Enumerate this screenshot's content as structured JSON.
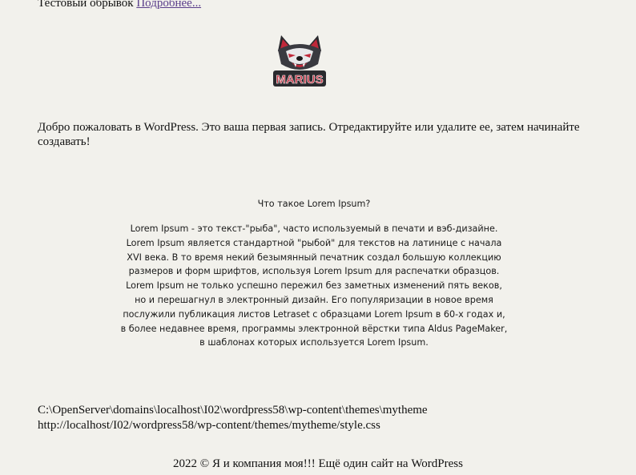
{
  "excerpt": {
    "text": "Тестовый обрывок",
    "more_link": "Подробнее..."
  },
  "logo": {
    "text": "MARIUS",
    "icon": "wolf-mascot-icon",
    "colors": {
      "red": "#c0283a",
      "dark": "#2a2a2e"
    }
  },
  "post": {
    "welcome": "Добро пожаловать в WordPress. Это ваша первая запись. Отредактируйте или удалите ее, затем начинайте создавать!"
  },
  "lorem": {
    "question": "Что такое Lorem Ipsum?",
    "lines": [
      "Lorem Ipsum - это текст-\"рыба\", часто используемый в печати и вэб-дизайне.",
      "Lorem Ipsum является стандартной \"рыбой\" для текстов на латинице с начала",
      "XVI века. В то время некий безымянный печатник создал большую коллекцию",
      "размеров и форм шрифтов, используя Lorem Ipsum для распечатки образцов.",
      "Lorem Ipsum не только успешно пережил без заметных изменений пять веков,",
      "но и перешагнул в электронный дизайн. Его популяризации в новое время",
      "послужили публикация листов Letraset с образцами Lorem Ipsum в 60-х годах и,",
      "в более недавнее время, программы электронной вёрстки типа Aldus PageMaker,",
      "в шаблонах которых используется Lorem Ipsum."
    ]
  },
  "paths": {
    "dir": "C:\\OpenServer\\domains\\localhost\\I02\\wordpress58\\wp-content\\themes\\mytheme",
    "url": "http://localhost/I02/wordpress58/wp-content/themes/mytheme/style.css"
  },
  "footer": {
    "text": "2022 © Я и компания моя!!! Ещё один сайт на WordPress"
  }
}
